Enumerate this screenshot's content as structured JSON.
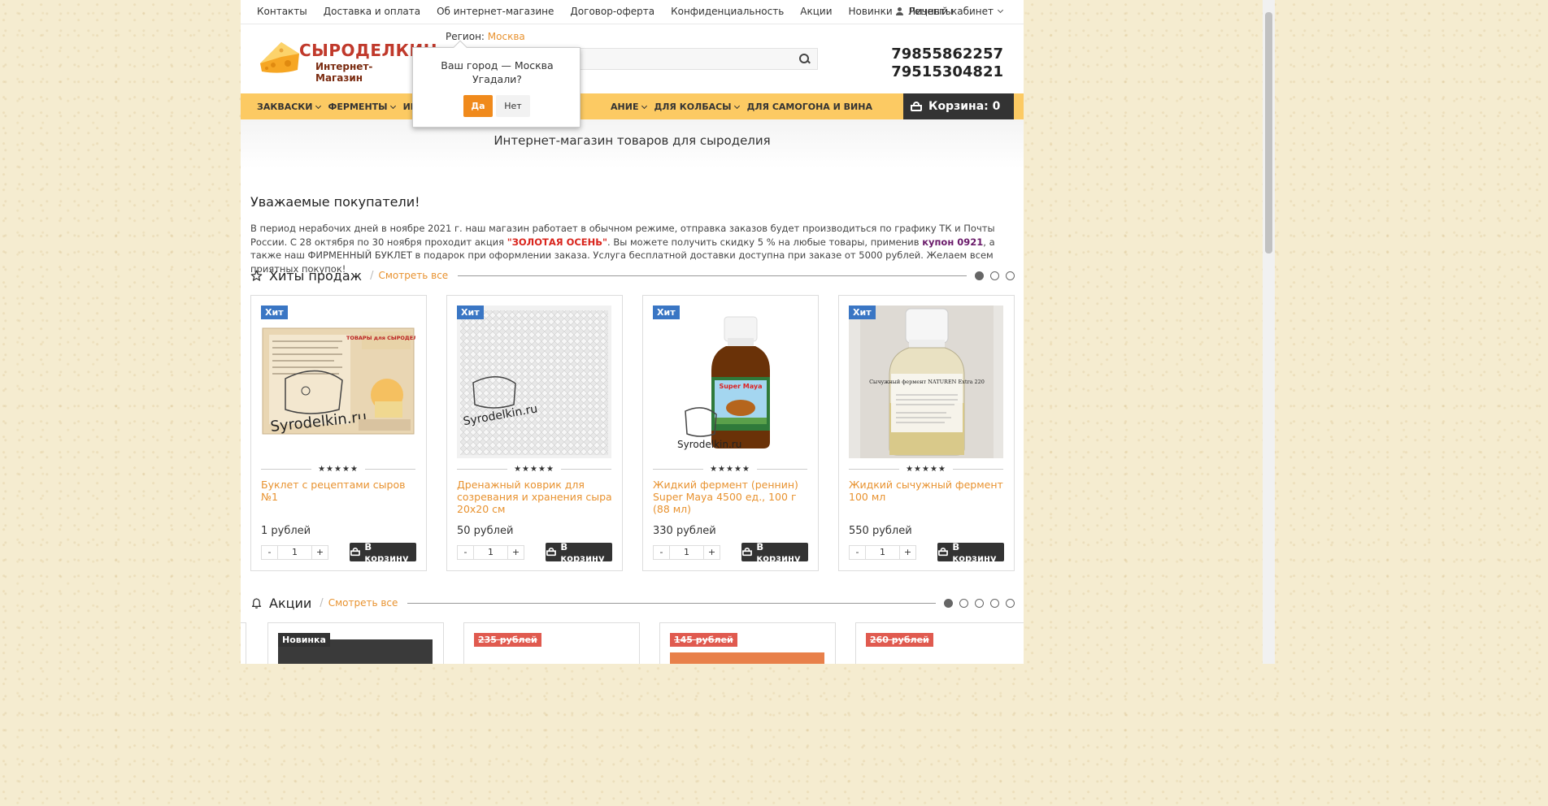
{
  "top_links": [
    "Контакты",
    "Доставка и оплата",
    "Об интернет-магазине",
    "Договор-оферта",
    "Конфиденциальность",
    "Акции",
    "Новинки",
    "Рецепты"
  ],
  "account_label": "Личный кабинет",
  "logo": {
    "brand": "СЫРОДЕЛКИН",
    "sub": "Интернет-Магазин"
  },
  "region": {
    "label": "Регион:",
    "city": "Москва"
  },
  "phones": [
    "79855862257",
    "79515304821"
  ],
  "nav": [
    "ЗАКВАСКИ",
    "ФЕРМЕНТЫ",
    "ИНГРЕДИЕНТЫ",
    "ОБОРУДОВАНИЕ",
    "ДЛЯ КОЛБАСЫ",
    "ДЛЯ САМОГОНА И ВИНА"
  ],
  "nav_visible": [
    "ЗАКВАСКИ",
    "ФЕРМЕНТЫ",
    "ИНГР",
    "АНИЕ",
    "ДЛЯ КОЛБАСЫ",
    "ДЛЯ САМОГОНА И ВИНА"
  ],
  "cart_label": "Корзина: 0",
  "popup": {
    "line1": "Ваш город — Москва",
    "line2": "Угадали?",
    "yes": "Да",
    "no": "Нет"
  },
  "banner_title": "Интернет-магазин товаров для сыроделия",
  "greeting": "Уважаемые покупатели!",
  "notice": {
    "p1": "В период нерабочих дней в ноябре 2021 г. наш магазин работает в обычном режиме, отправка заказов будет производиться по графику ТК и Почты России. С 28 октября по 30 ноября проходит акция ",
    "promo": "\"ЗОЛОТАЯ ОСЕНЬ\"",
    "p2": ". Вы можете получить скидку 5 % на любые товары, применив ",
    "coupon": "купон 0921",
    "p3": ", а также наш ФИРМЕННЫЙ БУКЛЕТ в подарок при оформлении заказа. Услуга бесплатной доставки доступна при заказе от 5000 рублей. Желаем всем приятных покупок!"
  },
  "hits": {
    "title": "Хиты продаж",
    "see_all": "Смотреть все",
    "products": [
      {
        "badge": "Хит",
        "name": "Буклет с рецептами сыров №1",
        "price": "1 рублей",
        "qty": "1",
        "buy": "В корзину"
      },
      {
        "badge": "Хит",
        "name": "Дренажный коврик для созревания и хранения сыра 20х20 см",
        "price": "50 рублей",
        "qty": "1",
        "buy": "В корзину"
      },
      {
        "badge": "Хит",
        "name": "Жидкий фермент (реннин) Super Maya 4500 ед., 100 г (88 мл)",
        "price": "330 рублей",
        "qty": "1",
        "buy": "В корзину"
      },
      {
        "badge": "Хит",
        "name": "Жидкий сычужный фермент 100 мл",
        "price": "550 рублей",
        "qty": "1",
        "buy": "В корзину"
      }
    ]
  },
  "promos": {
    "title": "Акции",
    "see_all": "Смотреть все",
    "cards": [
      {
        "badge": "Новинка"
      },
      {
        "old_price": "235 рублей"
      },
      {
        "old_price": "145 рублей"
      },
      {
        "old_price": "260 рублей"
      }
    ]
  },
  "rating_stars": "★★★★★",
  "image_texts": {
    "booklet_title": "ТОВАРЫ для СЫРОДЕЛИЯ",
    "watermark": "Syrodelkin.ru",
    "maya_label": "Super Maya",
    "naturen_label": "Сычужный фермент NATUREN Extra 220"
  },
  "colors": {
    "accent": "#e8922f",
    "nav_bg": "#fcca63",
    "dark": "#333333",
    "hit_badge": "#3a76c4",
    "old_price_badge": "#e05a4f"
  }
}
